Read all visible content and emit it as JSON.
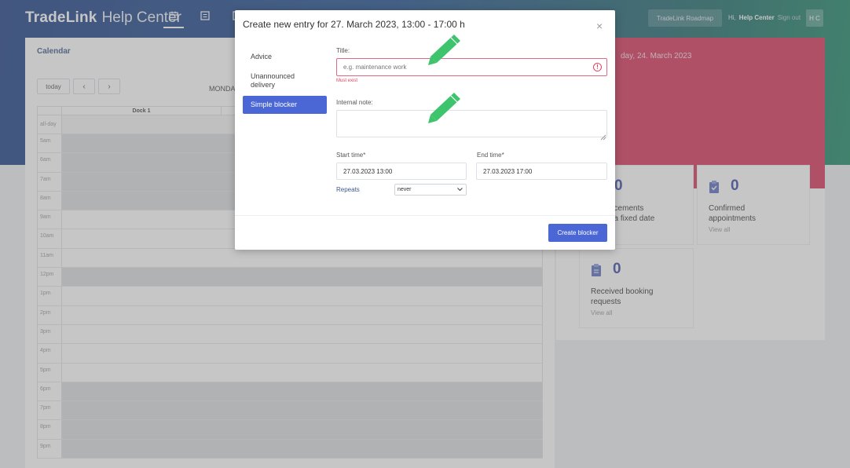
{
  "app": {
    "brand_bold": "TradeLink",
    "brand_light": "Help Center"
  },
  "header": {
    "nav_icons": [
      "calendar-icon",
      "list-icon",
      "report-icon"
    ],
    "roadmap_label": "TradeLink Roadmap",
    "greeting": "Hi,",
    "user_name": "Help Center",
    "sign_out": "Sign out",
    "avatar_initials": "H C"
  },
  "calendar": {
    "title": "Calendar",
    "today_label": "today",
    "prev_label": "‹",
    "next_label": "›",
    "date_partial": "MONDA",
    "column_header": "Dock 1",
    "allday_label": "all-day",
    "hours": [
      "5am",
      "6am",
      "7am",
      "8am",
      "9am",
      "10am",
      "11am",
      "12pm",
      "1pm",
      "2pm",
      "3pm",
      "4pm",
      "5pm",
      "6pm",
      "7pm",
      "8pm",
      "9pm"
    ]
  },
  "dashboard": {
    "date_partial": "day, 24. March 2023",
    "cards": [
      {
        "count": "0",
        "text_line1": "ncements",
        "text_line2": "t a fixed date",
        "link": ""
      },
      {
        "count": "0",
        "text_line1": "Confirmed",
        "text_line2": "appointments",
        "link": "View all"
      },
      {
        "count": "0",
        "text_line1": "Received booking",
        "text_line2": "requests",
        "link": "View all"
      }
    ]
  },
  "modal": {
    "title": "Create new entry for 27. March 2023, 13:00 - 17:00 h",
    "close_label": "×",
    "menu": [
      "Advice",
      "Unannounced delivery",
      "Simple blocker"
    ],
    "active_menu_index": 2,
    "title_label": "Title:",
    "title_placeholder": "e.g. maintenance work",
    "title_error": "Must exist",
    "note_label": "Internal note:",
    "start_label": "Start time*",
    "start_value": "27.03.2023 13:00",
    "end_label": "End time*",
    "end_value": "27.03.2023 17:00",
    "repeats_label": "Repeats",
    "repeats_value": "never",
    "create_label": "Create blocker"
  },
  "colors": {
    "accent": "#4b67d6",
    "error": "#e0445f",
    "pink_panel": "#d7345c",
    "pencil": "#3ec46d"
  }
}
